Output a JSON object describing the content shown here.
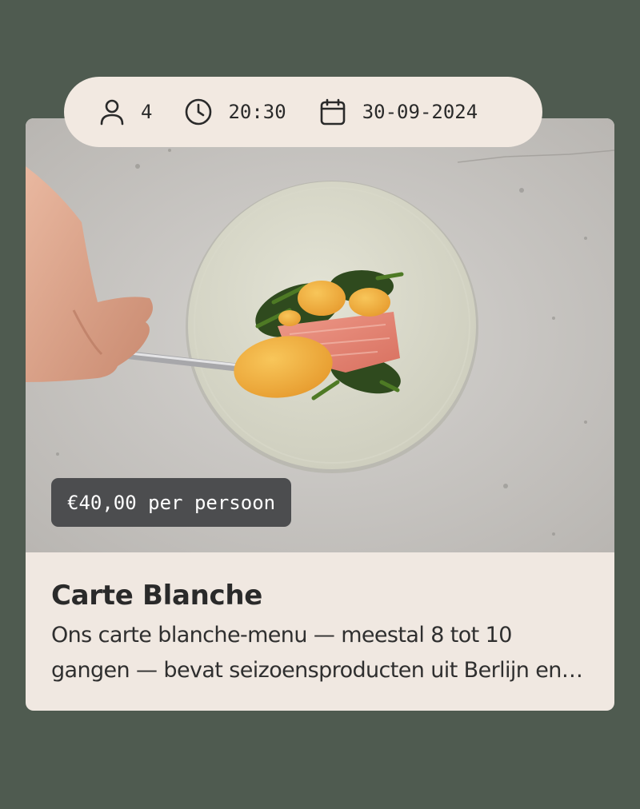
{
  "booking": {
    "guests": "4",
    "time": "20:30",
    "date": "30-09-2024",
    "icons": {
      "guests": "person-icon",
      "time": "clock-icon",
      "date": "calendar-icon"
    }
  },
  "menu": {
    "price": "€40,00 per persoon",
    "title": "Carte Blanche",
    "description": "Ons carte blanche-menu — meestal 8 tot 10 gangen — bevat seizoensproducten uit Berlijn en omgeving"
  },
  "colors": {
    "background": "#4f5b50",
    "card": "#f0e8e1",
    "badge": "#4c4d4f",
    "text": "#2a2a2a"
  }
}
